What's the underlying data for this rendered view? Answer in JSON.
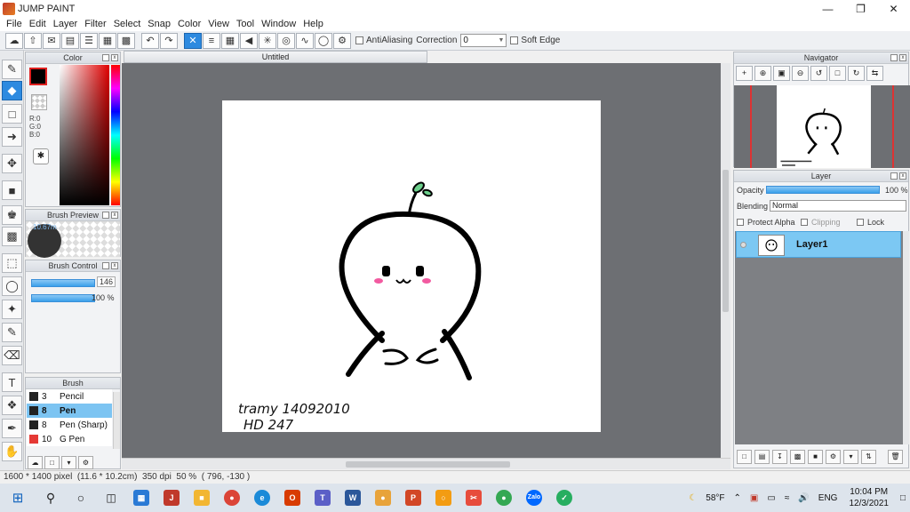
{
  "app": {
    "title": "JUMP PAINT"
  },
  "menu": [
    "File",
    "Edit",
    "Layer",
    "Filter",
    "Select",
    "Snap",
    "Color",
    "View",
    "Tool",
    "Window",
    "Help"
  ],
  "toolbar": {
    "antialiasing_label": "AntiAliasing",
    "correction_label": "Correction",
    "correction_value": "0",
    "soft_edge_label": "Soft Edge"
  },
  "panels": {
    "color": {
      "title": "Color",
      "rgb_r": "R:0",
      "rgb_g": "G:0",
      "rgb_b": "B:0",
      "foreground_color": "#000000"
    },
    "brush_preview": {
      "title": "Brush Preview",
      "size_label": "10.67m"
    },
    "brush_control": {
      "title": "Brush Control",
      "size_value": "146",
      "opacity_value": "100 %"
    },
    "brush": {
      "title": "Brush",
      "items": [
        {
          "size": "3",
          "name": "Pencil",
          "color": "#222222"
        },
        {
          "size": "8",
          "name": "Pen",
          "color": "#222222",
          "selected": true
        },
        {
          "size": "8",
          "name": "Pen (Sharp)",
          "color": "#222222"
        },
        {
          "size": "10",
          "name": "G Pen",
          "color": "#e53935"
        }
      ]
    },
    "navigator": {
      "title": "Navigator"
    },
    "layer": {
      "title": "Layer",
      "opacity_label": "Opacity",
      "opacity_value": "100 %",
      "blending_label": "Blending",
      "blending_value": "Normal",
      "protect_alpha_label": "Protect Alpha",
      "clipping_label": "Clipping",
      "lock_label": "Lock",
      "layers": [
        {
          "name": "Layer1"
        }
      ]
    }
  },
  "canvas": {
    "tab_title": "Untitled",
    "signature_line1": "tramy 14092010",
    "signature_line2": "HD 247"
  },
  "status": {
    "text": "1600 * 1400 pixel  (11.6 * 10.2cm)  350 dpi  50 %  ( 796, -130 )"
  },
  "taskbar": {
    "weather": "58°F",
    "language": "ENG",
    "time": "10:04 PM",
    "date": "12/3/2021"
  }
}
